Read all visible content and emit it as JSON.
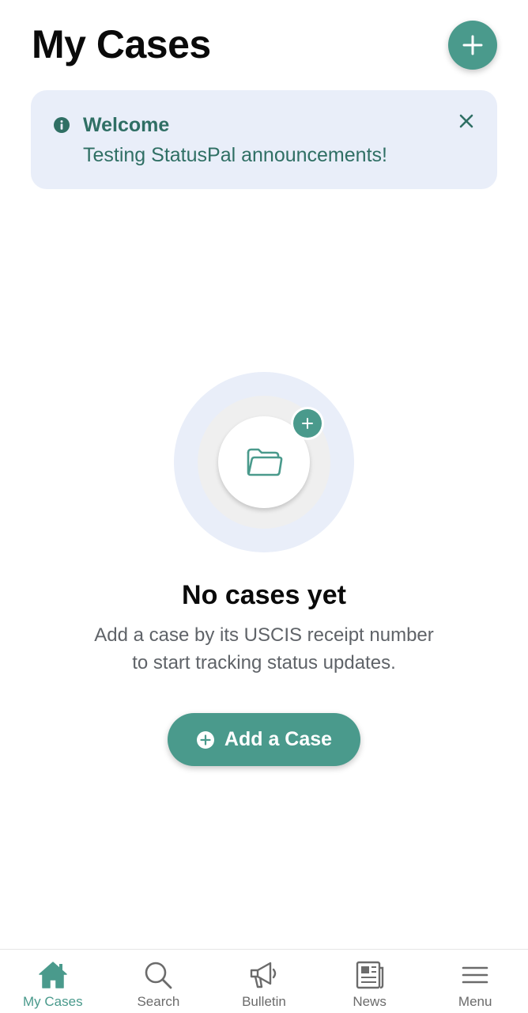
{
  "header": {
    "title": "My Cases"
  },
  "announcement": {
    "title": "Welcome",
    "message": "Testing StatusPal announcements!"
  },
  "empty_state": {
    "title": "No cases yet",
    "description_line1": "Add a case by its USCIS receipt number",
    "description_line2": "to start tracking status updates.",
    "button_label": "Add a Case"
  },
  "bottom_nav": {
    "active": "My Cases",
    "items": [
      {
        "label": "My Cases",
        "icon": "home-icon"
      },
      {
        "label": "Search",
        "icon": "search-icon"
      },
      {
        "label": "Bulletin",
        "icon": "megaphone-icon"
      },
      {
        "label": "News",
        "icon": "newspaper-icon"
      },
      {
        "label": "Menu",
        "icon": "hamburger-menu-icon"
      }
    ]
  },
  "colors": {
    "accent": "#4a9a8c",
    "announcement_bg": "#e9eef9",
    "announcement_text": "#2f6f64",
    "title_text": "#0a0a0a",
    "muted_text": "#5f6368",
    "nav_inactive": "#6b6b6b"
  }
}
